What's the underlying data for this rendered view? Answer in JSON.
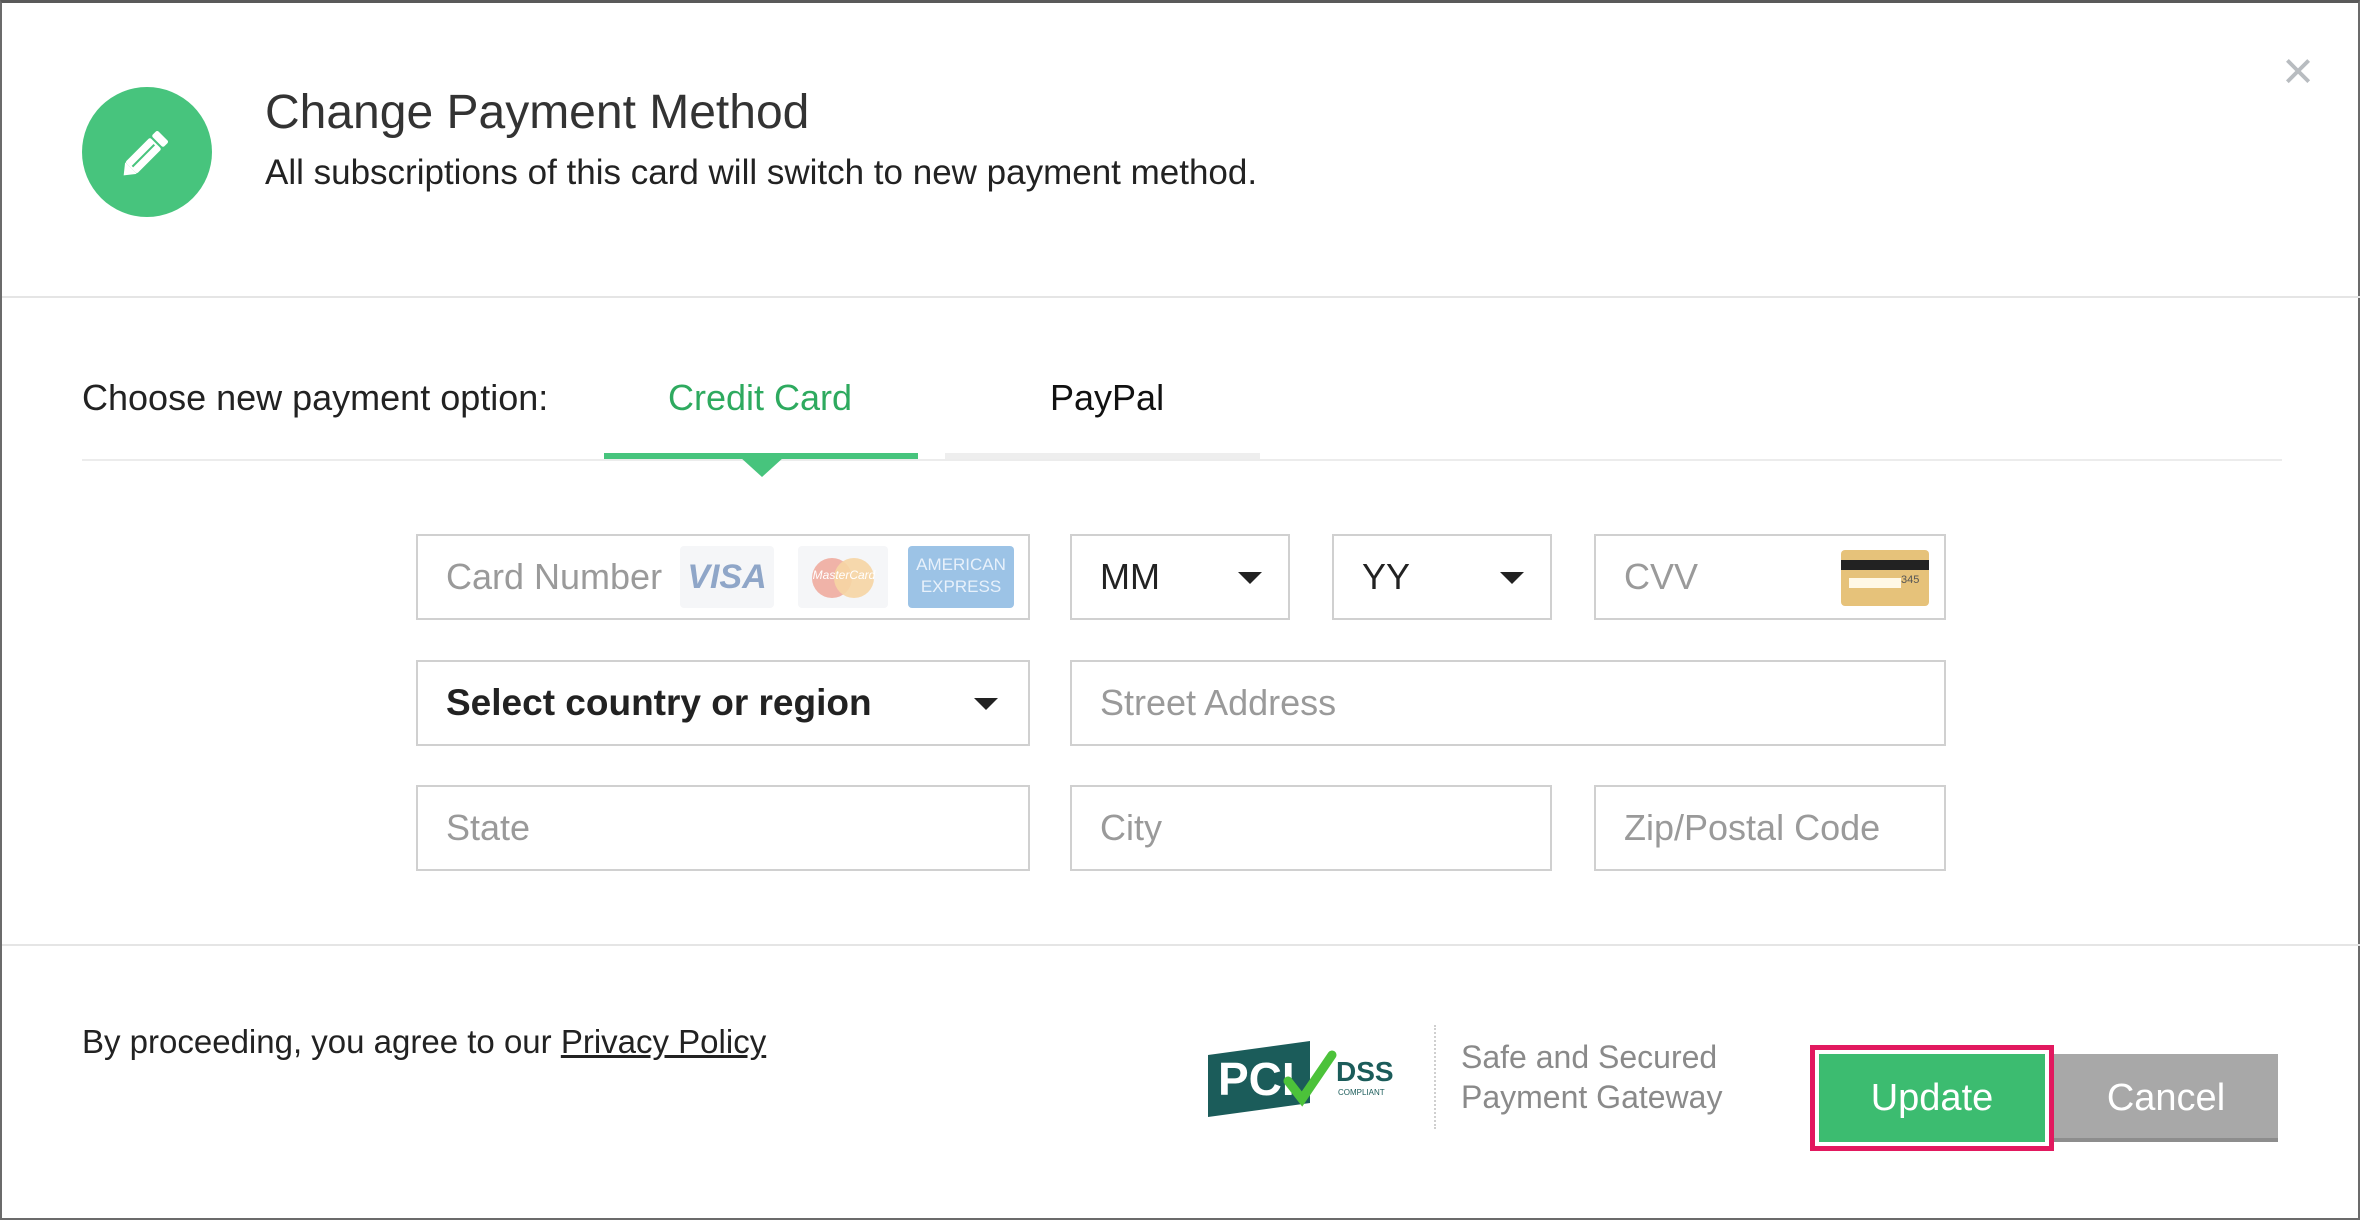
{
  "header": {
    "title": "Change Payment Method",
    "subtitle": "All subscriptions of this card will switch to new payment method.",
    "close_glyph": "×",
    "icon": "pencil-icon",
    "accent_color": "#47c47d"
  },
  "payment_options": {
    "label": "Choose new payment option:",
    "tabs": [
      {
        "label": "Credit Card",
        "active": true
      },
      {
        "label": "PayPal",
        "active": false
      }
    ]
  },
  "form": {
    "card_number": {
      "placeholder": "Card Number",
      "logos": [
        "VISA",
        "MasterCard",
        "AMERICAN EXPRESS"
      ]
    },
    "exp_month": {
      "value": "MM"
    },
    "exp_year": {
      "value": "YY"
    },
    "cvv": {
      "placeholder": "CVV",
      "card_digits": "345"
    },
    "country": {
      "value": "Select country or region"
    },
    "street": {
      "placeholder": "Street Address"
    },
    "state": {
      "placeholder": "State"
    },
    "city": {
      "placeholder": "City"
    },
    "zip": {
      "placeholder": "Zip/Postal Code"
    }
  },
  "footer": {
    "agree_text": "By proceeding, you agree to our",
    "privacy_link": "Privacy Policy",
    "pci": {
      "main": "PCI",
      "dss": "DSS",
      "compliant": "COMPLIANT"
    },
    "secure_line1": "Safe and Secured",
    "secure_line2": "Payment Gateway",
    "update_label": "Update",
    "cancel_label": "Cancel"
  }
}
